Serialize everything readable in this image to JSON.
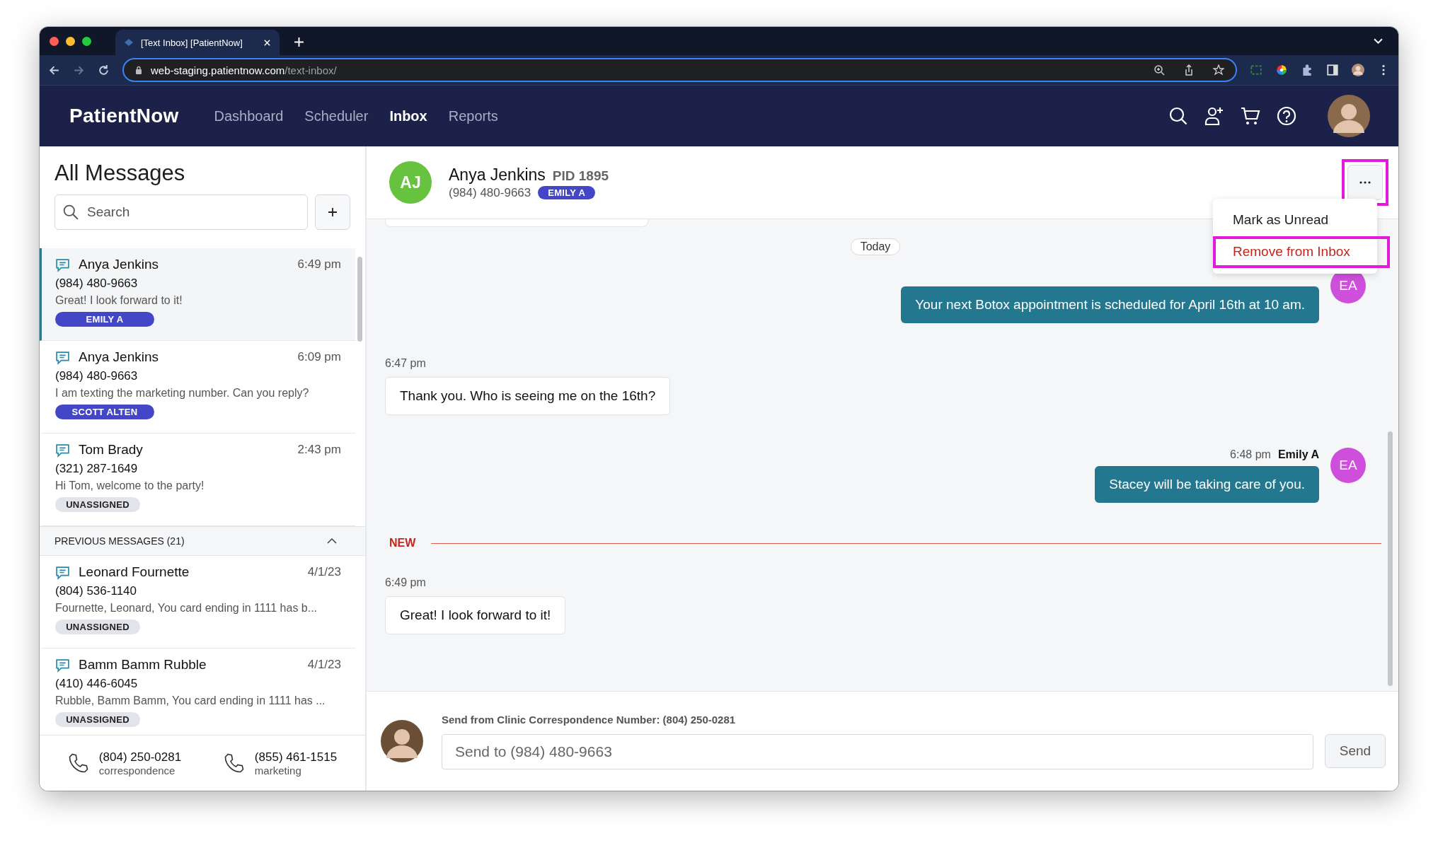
{
  "browser": {
    "tab_title": "[Text Inbox] [PatientNow]",
    "url_host": "web-staging.patientnow.com",
    "url_path": "/text-inbox/"
  },
  "nav": {
    "logo": "PatientNow",
    "items": [
      {
        "label": "Dashboard",
        "selected": false
      },
      {
        "label": "Scheduler",
        "selected": false
      },
      {
        "label": "Inbox",
        "selected": true
      },
      {
        "label": "Reports",
        "selected": false
      }
    ]
  },
  "sidebar": {
    "title": "All Messages",
    "search": {
      "placeholder": "Search"
    },
    "conversations": [
      {
        "name": "Anya Jenkins",
        "time": "6:49 pm",
        "phone": "(984) 480-9663",
        "preview": "Great! I look forward to it!",
        "assignee": {
          "label": "EMILY A",
          "kind": "assigned"
        },
        "selected": true
      },
      {
        "name": "Anya Jenkins",
        "time": "6:09 pm",
        "phone": "(984) 480-9663",
        "preview": "I am texting the marketing number. Can you reply?",
        "assignee": {
          "label": "SCOTT ALTEN",
          "kind": "assigned"
        },
        "selected": false
      },
      {
        "name": "Tom Brady",
        "time": "2:43 pm",
        "phone": "(321) 287-1649",
        "preview": "Hi Tom, welcome to the party!",
        "assignee": {
          "label": "UNASSIGNED",
          "kind": "unassigned"
        },
        "selected": false
      }
    ],
    "previous": {
      "label": "PREVIOUS MESSAGES (21)",
      "expanded": true,
      "conversations": [
        {
          "name": "Leonard Fournette",
          "time": "4/1/23",
          "phone": "(804) 536-1140",
          "preview": "Fournette, Leonard, You card ending in 1111 has b...",
          "assignee": {
            "label": "UNASSIGNED",
            "kind": "unassigned"
          },
          "selected": false
        },
        {
          "name": "Bamm Bamm Rubble",
          "time": "4/1/23",
          "phone": "(410) 446-6045",
          "preview": "Rubble, Bamm Bamm, You card ending in 1111 has ...",
          "assignee": {
            "label": "UNASSIGNED",
            "kind": "unassigned"
          },
          "selected": false
        }
      ]
    },
    "phones": [
      {
        "number": "(804) 250-0281",
        "label": "correspondence"
      },
      {
        "number": "(855) 461-1515",
        "label": "marketing"
      }
    ]
  },
  "chat": {
    "header": {
      "initials": "AJ",
      "name": "Anya Jenkins",
      "pid": "PID 1895",
      "phone": "(984) 480-9663",
      "assignee": "EMILY A",
      "menu_button_highlighted": true
    },
    "menu": {
      "items": [
        {
          "label": "Mark as Unread",
          "kind": "normal",
          "highlighted": false
        },
        {
          "label": "Remove from Inbox",
          "kind": "danger",
          "highlighted": true
        }
      ]
    },
    "messages": [
      {
        "kind": "date",
        "text": "Today"
      },
      {
        "kind": "outgoing",
        "text": "Your next Botox appointment is scheduled for April 16th at 10 am.",
        "initials": "EA"
      },
      {
        "kind": "incoming",
        "time": "6:47 pm",
        "text": "Thank you. Who is seeing me on the 16th?"
      },
      {
        "kind": "outgoing",
        "time": "6:48 pm",
        "sender": "Emily A",
        "text": "Stacey will be taking care of you.",
        "initials": "EA"
      },
      {
        "kind": "divider",
        "text": "NEW"
      },
      {
        "kind": "incoming",
        "time": "6:49 pm",
        "text": "Great! I look forward to it!"
      }
    ],
    "composer": {
      "from_label": "Send from Clinic Correspondence Number: (804) 250-0281",
      "placeholder": "Send to (984) 480-9663",
      "send": "Send"
    }
  }
}
